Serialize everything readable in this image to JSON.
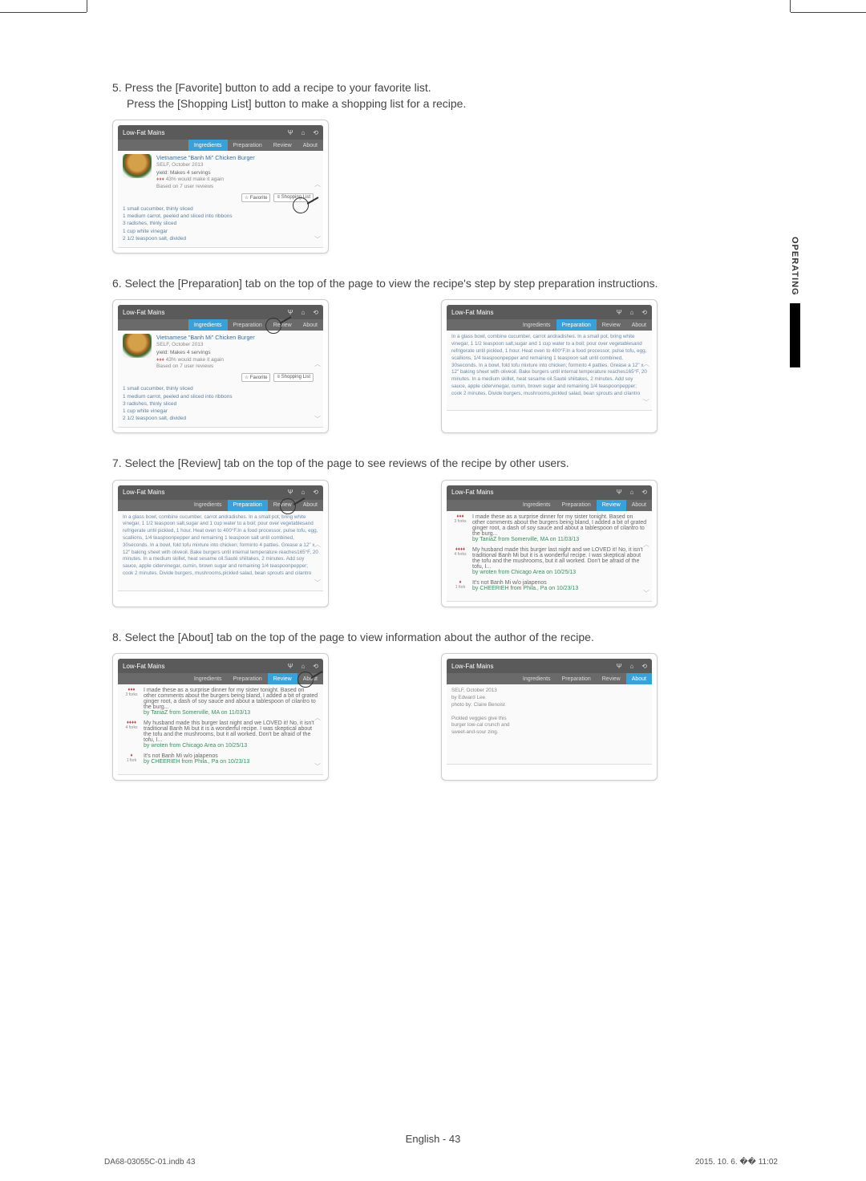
{
  "steps": {
    "s5a": "5.  Press the [Favorite] button to add a recipe to your favorite list.",
    "s5b": "Press the [Shopping List] button to make a shopping list for a recipe.",
    "s6": "6.  Select the [Preparation] tab on the top of the page to view the recipe's step by step preparation instructions.",
    "s7": "7.  Select the [Review] tab on the top of the page to see reviews of the recipe by other users.",
    "s8": "8.  Select the [About] tab on the top of the page to view information about the author of the recipe."
  },
  "side_tab": "OPERATING",
  "header_title": "Low-Fat Mains",
  "tabs": {
    "ingredients": "Ingredients",
    "preparation": "Preparation",
    "review": "Review",
    "about": "About"
  },
  "recipe": {
    "title": "Vietnamese \"Banh Mi\" Chicken Burger",
    "source": "SELF, October 2013",
    "yield_label": "yield:",
    "yield": "Makes 4 servings",
    "make_again": "43% would make it again",
    "based_on": "Based on 7 user reviews"
  },
  "action_buttons": {
    "favorite": "☆ Favorite",
    "shopping": "≡ Shopping List"
  },
  "ingredients": [
    "1 small cucumber, thinly sliced",
    "1 medium carrot, peeled and sliced into ribbons",
    "3 radishes, thinly sliced",
    "1 cup white vinegar",
    "2 1/2 teaspoon salt, divided"
  ],
  "preparation_text": "In a glass bowl, combine cucumber, carrot andradishes. In a small pot, bring white vinegar, 1 1/2 teaspoon salt,sugar and 1 cup water to a boil; pour over vegetablesand refrigerate until pickled, 1 hour. Heat oven to 400°F.In a food processor, pulse tofu, egg, scallions, 1/4 teaspoonpepper and remaining 1 teaspoon salt until combined, 30seconds. In a bowl, fold tofu mixture into chicken; forminto 4 patties. Grease a 12\" x 12\" baking sheet with oliveoil. Bake burgers until internal temperature reaches165°F, 20 minutes. In a medium skillet, heat sesame oil.Sauté shiitakes, 2 minutes. Add soy sauce, apple cidervinegar, cumin, brown sugar and remaining 1/4 teaspoonpepper; cook 2 minutes. Divide burgers, mushrooms,pickled salad, bean sprouts and cilantro",
  "reviews": [
    {
      "rating_label": "3 forks",
      "text": "I made these as a surprise dinner for my sister tonight. Based on other comments about the burgers being bland, I added a bit of grated ginger root, a dash of soy sauce and about a tablespoon of cilantro to the burg...",
      "author": "by TaniaZ from Somerville, MA on 11/03/13"
    },
    {
      "rating_label": "4 forks",
      "text": "My husband made this burger last night and we LOVED it! No, it isn't traditional Banh Mi but it is a wonderful recipe. I was skeptical about the tofu and the mushrooms, but it all worked. Don't be afraid of the tofu, I...",
      "author": "by wroten from Chicago Area on 10/25/13"
    },
    {
      "rating_label": "1 fork",
      "text": "It's not Banh Mi w/o jalapenos",
      "author": "by CHEERIEH from Phila., Pa on 10/23/13"
    }
  ],
  "about": {
    "source": "SELF, October 2013",
    "author": "by Edward Lee",
    "photo": "photo by: Claire Benoist",
    "description1": "Pickled veggies give this",
    "description2": "burger low-cal crunch and",
    "description3": "sweet-and-sour zing."
  },
  "footer_center": "English - 43",
  "footer_left": "DA68-03055C-01.indb   43",
  "footer_right": "2015. 10. 6.   �� 11:02"
}
